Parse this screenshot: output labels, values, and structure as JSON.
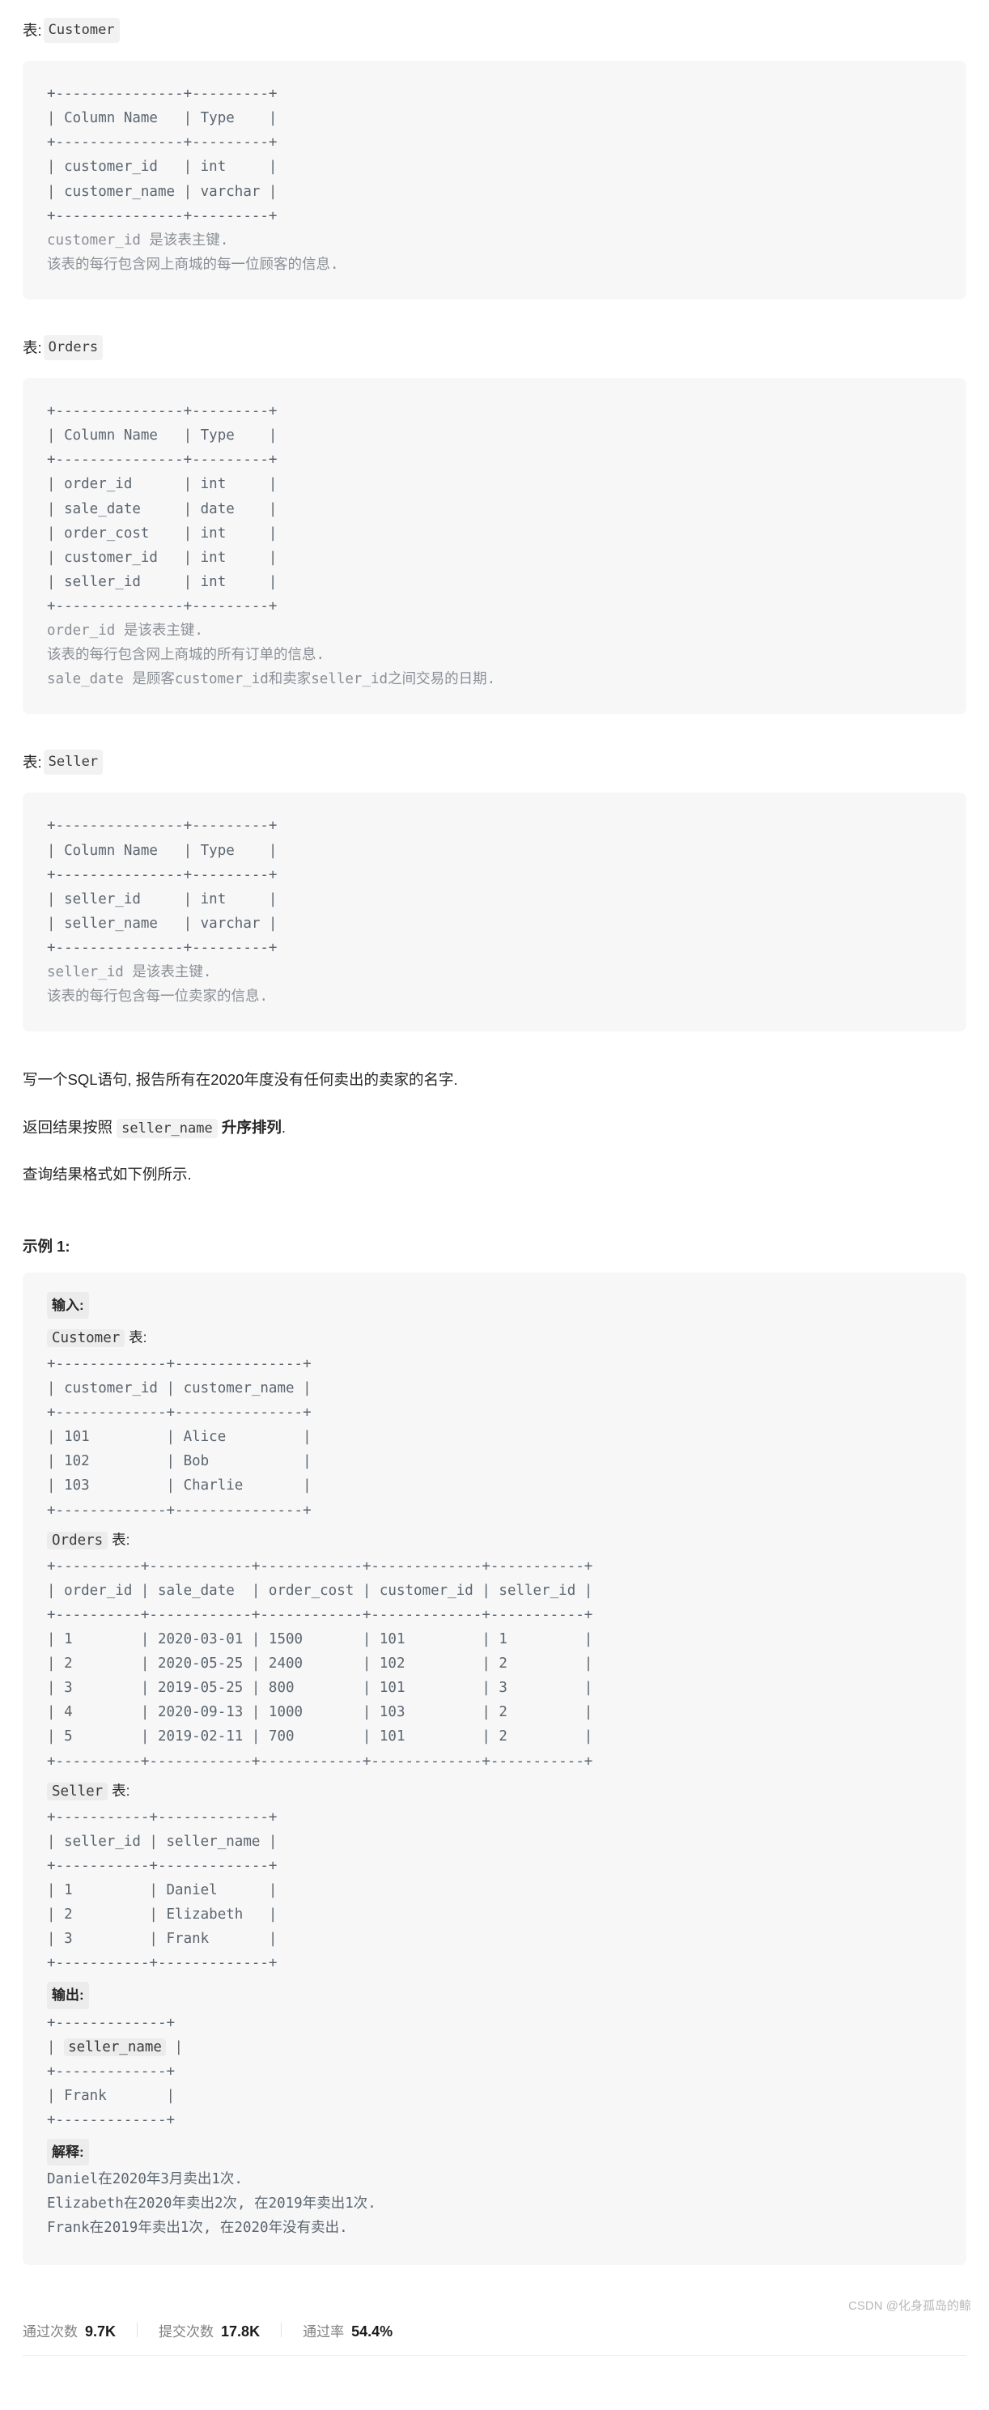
{
  "tables": [
    {
      "caption_prefix": "表",
      "caption_colon": ": ",
      "caption_name": "Customer",
      "schema_ascii": "+---------------+---------+\n| Column Name   | Type    |\n+---------------+---------+\n| customer_id   | int     |\n| customer_name | varchar |\n+---------------+---------+",
      "notes": "customer_id 是该表主键.\n该表的每行包含网上商城的每一位顾客的信息."
    },
    {
      "caption_prefix": "表",
      "caption_colon": ": ",
      "caption_name": "Orders",
      "schema_ascii": "+---------------+---------+\n| Column Name   | Type    |\n+---------------+---------+\n| order_id      | int     |\n| sale_date     | date    |\n| order_cost    | int     |\n| customer_id   | int     |\n| seller_id     | int     |\n+---------------+---------+",
      "notes": "order_id 是该表主键.\n该表的每行包含网上商城的所有订单的信息.\nsale_date 是顾客customer_id和卖家seller_id之间交易的日期."
    },
    {
      "caption_prefix": "表",
      "caption_colon": ": ",
      "caption_name": "Seller",
      "schema_ascii": "+---------------+---------+\n| Column Name   | Type    |\n+---------------+---------+\n| seller_id     | int     |\n| seller_name   | varchar |\n+---------------+---------+",
      "notes": "seller_id 是该表主键.\n该表的每行包含每一位卖家的信息."
    }
  ],
  "problem": {
    "statement": "写一个SQL语句, 报告所有在2020年度没有任何卖出的卖家的名字.",
    "order_prefix": "返回结果按照 ",
    "order_code": "seller_name",
    "order_bold": "升序排列",
    "order_suffix": ".",
    "format_note": "查询结果格式如下例所示."
  },
  "example": {
    "title": "示例 1:",
    "input_label": "输入:",
    "customer_table_name": "Customer",
    "customer_table_suffix": " 表:",
    "customer_ascii": "+-------------+---------------+\n| customer_id | customer_name |\n+-------------+---------------+\n| 101         | Alice         |\n| 102         | Bob           |\n| 103         | Charlie       |\n+-------------+---------------+",
    "orders_table_name": "Orders",
    "orders_table_suffix": " 表:",
    "orders_ascii": "+----------+------------+------------+-------------+-----------+\n| order_id | sale_date  | order_cost | customer_id | seller_id |\n+----------+------------+------------+-------------+-----------+\n| 1        | 2020-03-01 | 1500       | 101         | 1         |\n| 2        | 2020-05-25 | 2400       | 102         | 2         |\n| 3        | 2019-05-25 | 800        | 101         | 3         |\n| 4        | 2020-09-13 | 1000       | 103         | 2         |\n| 5        | 2019-02-11 | 700        | 101         | 2         |\n+----------+------------+------------+-------------+-----------+",
    "seller_table_name": "Seller",
    "seller_table_suffix": " 表:",
    "seller_ascii": "+-----------+-------------+\n| seller_id | seller_name |\n+-----------+-------------+\n| 1         | Daniel      |\n| 2         | Elizabeth   |\n| 3         | Frank       |\n+-----------+-------------+",
    "output_label": "输出:",
    "output_top_border": "+-------------+",
    "output_header_pre": "| ",
    "output_header_code": "seller_name",
    "output_header_post": " |",
    "output_rest": "+-------------+\n| Frank       |\n+-------------+",
    "explain_label": "解释:",
    "explain_lines": "Daniel在2020年3月卖出1次.\nElizabeth在2020年卖出2次, 在2019年卖出1次.\nFrank在2019年卖出1次, 在2020年没有卖出."
  },
  "stats": [
    {
      "label": "通过次数",
      "value": "9.7K"
    },
    {
      "label": "提交次数",
      "value": "17.8K"
    },
    {
      "label": "通过率",
      "value": "54.4%"
    }
  ],
  "watermark": "CSDN @化身孤岛的鲸"
}
